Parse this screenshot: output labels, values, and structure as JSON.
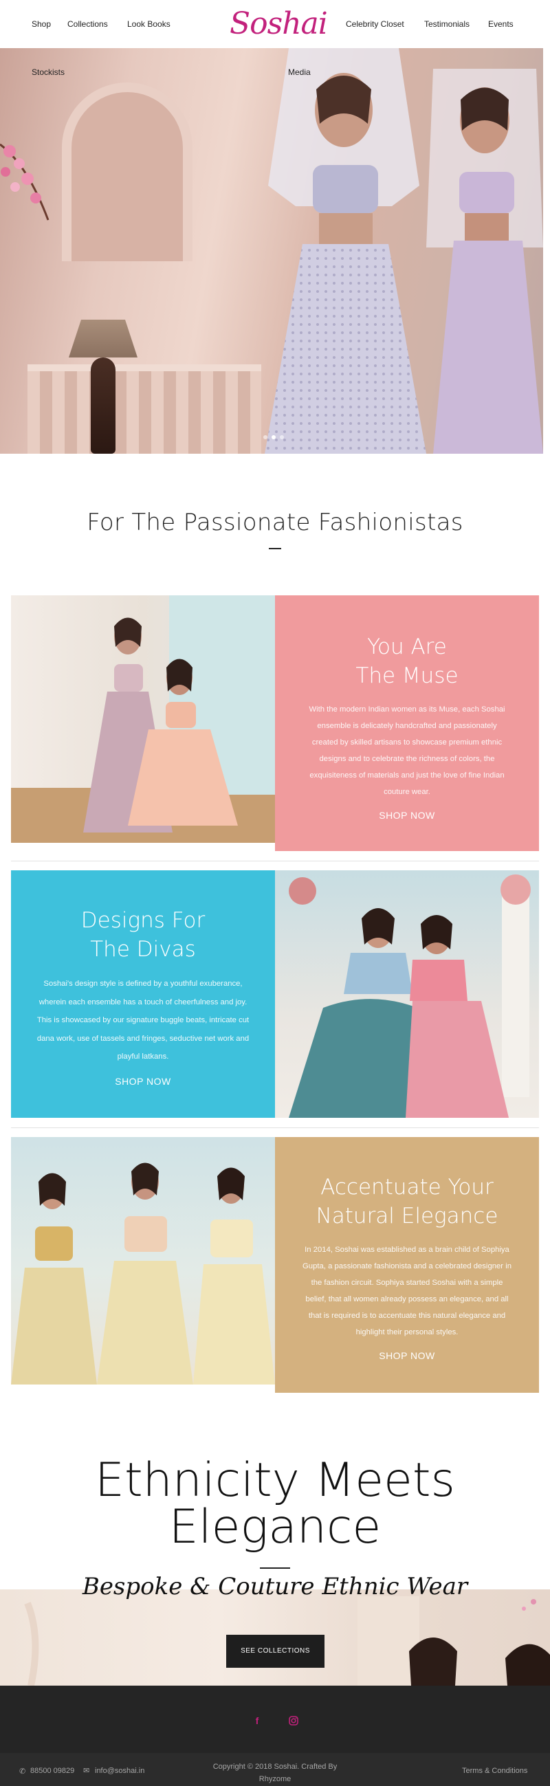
{
  "header": {
    "logo": "Soshai",
    "nav_left": [
      "Shop",
      "Collections",
      "Look Books"
    ],
    "nav_right": [
      "Celebrity Closet",
      "Testimonials",
      "Events"
    ],
    "nav_row2": [
      "Stockists",
      "Media"
    ]
  },
  "hero": {
    "slides": 3,
    "active_slide": 2
  },
  "intro": {
    "title": "For The Passionate Fashionistas"
  },
  "features": [
    {
      "title_line1": "You Are",
      "title_line2": "The Muse",
      "body": "With the modern Indian women as its Muse, each Soshai ensemble is delicately handcrafted and passionately created by skilled artisans to showcase premium ethnic designs and to celebrate the richness of colors, the exquisiteness of materials and just the love of fine Indian couture wear.",
      "cta": "SHOP NOW",
      "color": "#f09b9d"
    },
    {
      "title_line1": "Designs For",
      "title_line2": "The Divas",
      "body": "Soshai's design style is defined by a youthful exuberance, wherein each ensemble has a touch of cheerfulness and joy. This is showcased by our signature buggle beats, intricate cut dana work, use of tassels and fringes, seductive net work and playful latkans.",
      "cta": "SHOP NOW",
      "color": "#3ec1dc"
    },
    {
      "title_line1": "Accentuate Your",
      "title_line2": "Natural Elegance",
      "body": "In 2014, Soshai was established as a brain child of Sophiya Gupta, a passionate fashionista and a celebrated designer in the fashion circuit. Sophiya started Soshai with a simple belief, that all women already possess an elegance, and all that is required is to accentuate this natural elegance and highlight their personal styles.",
      "cta": "SHOP NOW",
      "color": "#d4b17f"
    }
  ],
  "showcase": {
    "title_line1": "Ethnicity Meets",
    "title_line2": "Elegance",
    "script": "Bespoke & Couture Ethnic Wear",
    "cta": "SEE COLLECTIONS"
  },
  "footer": {
    "social": [
      {
        "icon": "facebook-icon",
        "glyph": "f"
      },
      {
        "icon": "instagram-icon",
        "glyph": "◘"
      }
    ],
    "phone": "88500 09829",
    "email": "info@soshai.in",
    "copyright_line1": "Copyright © 2018 Soshai. Crafted By",
    "copyright_line2": "Rhyzome",
    "terms": "Terms & Conditions",
    "accent": "#c2217c"
  }
}
